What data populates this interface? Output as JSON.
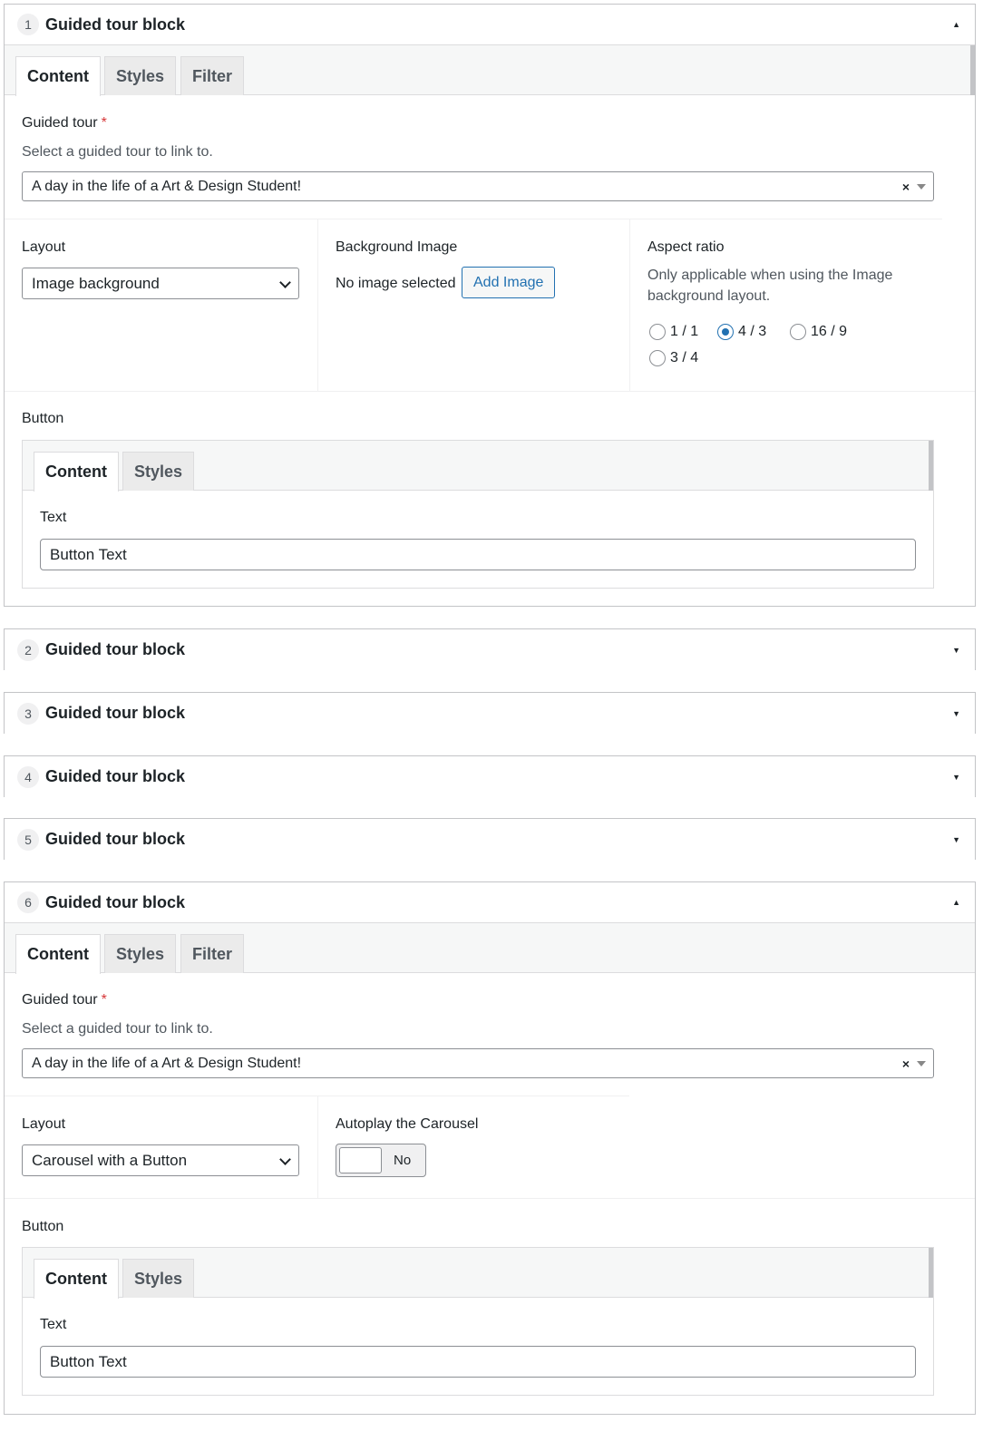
{
  "blocks": [
    {
      "num": "1",
      "title": "Guided tour block",
      "open": true
    },
    {
      "num": "2",
      "title": "Guided tour block",
      "open": false
    },
    {
      "num": "3",
      "title": "Guided tour block",
      "open": false
    },
    {
      "num": "4",
      "title": "Guided tour block",
      "open": false
    },
    {
      "num": "5",
      "title": "Guided tour block",
      "open": false
    },
    {
      "num": "6",
      "title": "Guided tour block",
      "open": true
    }
  ],
  "toggle_up": "▲",
  "toggle_down": "▼",
  "tabs": {
    "content": "Content",
    "styles": "Styles",
    "filter": "Filter"
  },
  "guided_tour": {
    "label": "Guided tour",
    "required": "*",
    "description": "Select a guided tour to link to.",
    "value": "A day in the life of a Art & Design Student!",
    "clear": "×"
  },
  "block1": {
    "layout_label": "Layout",
    "layout_value": "Image background",
    "bg_label": "Background Image",
    "bg_status": "No image selected",
    "add_image": "Add Image",
    "aspect_label": "Aspect ratio",
    "aspect_desc_1": "Only applicable when using the Image",
    "aspect_desc_2": "background layout.",
    "ratios": [
      {
        "label": "1 / 1",
        "checked": false
      },
      {
        "label": "4 / 3",
        "checked": true
      },
      {
        "label": "16 / 9",
        "checked": false
      },
      {
        "label": "3 / 4",
        "checked": false
      }
    ]
  },
  "block6": {
    "layout_label": "Layout",
    "layout_value": "Carousel with a Button",
    "autoplay_label": "Autoplay the Carousel",
    "autoplay_value": "No"
  },
  "button_section": {
    "label": "Button",
    "text_label": "Text",
    "text_value": "Button Text"
  },
  "colors": {
    "accent": "#2271b1",
    "required": "#d63638",
    "border": "#c3c4c7"
  }
}
